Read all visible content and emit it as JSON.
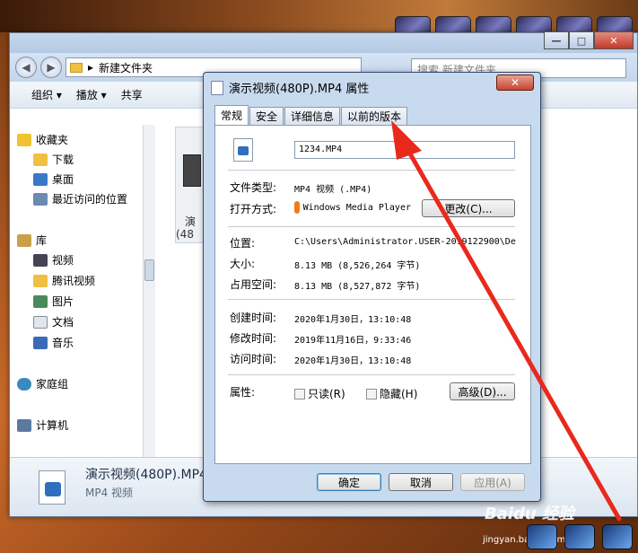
{
  "explorer": {
    "breadcrumb": "新建文件夹",
    "search_placeholder": "搜索 新建文件夹",
    "toolbar": {
      "organize": "组织 ▾",
      "play": "播放 ▾",
      "share": "共享"
    },
    "sidebar": {
      "favorites": "收藏夹",
      "downloads": "下载",
      "desktop": "桌面",
      "recent": "最近访问的位置",
      "libraries": "库",
      "videos": "视频",
      "tencent_video": "腾讯视频",
      "pictures": "图片",
      "documents": "文档",
      "music": "音乐",
      "homegroup": "家庭组",
      "computer": "计算机"
    },
    "file_thumb_label_1": "演",
    "file_thumb_label_2": "(48",
    "details": {
      "name": "演示视频(480P).MP4",
      "type": "MP4 视频"
    }
  },
  "dialog": {
    "title": "演示视频(480P).MP4 属性",
    "close_label": "✕",
    "tabs": [
      "常规",
      "安全",
      "详细信息",
      "以前的版本"
    ],
    "file_name": "1234.MP4",
    "labels": {
      "file_type": "文件类型:",
      "open_with": "打开方式:",
      "location": "位置:",
      "size": "大小:",
      "size_on_disk": "占用空间:",
      "created": "创建时间:",
      "modified": "修改时间:",
      "accessed": "访问时间:",
      "attributes": "属性:"
    },
    "values": {
      "file_type": "MP4 视频 (.MP4)",
      "open_with": "Windows Media Player",
      "location": "C:\\Users\\Administrator.USER-2019122900\\De",
      "size": "8.13 MB (8,526,264 字节)",
      "size_on_disk": "8.13 MB (8,527,872 字节)",
      "created": "2020年1月30日，13:10:48",
      "modified": "2019年11月16日，9:33:46",
      "accessed": "2020年1月30日，13:10:48"
    },
    "change_button": "更改(C)...",
    "readonly": "只读(R)",
    "hidden": "隐藏(H)",
    "advanced_button": "高级(D)...",
    "ok": "确定",
    "cancel": "取消",
    "apply": "应用(A)"
  },
  "watermark": {
    "main": "Baidu 经验",
    "sub": "jingyan.baidu.com"
  },
  "colors": {
    "arrow": "#e8291c",
    "dialog_frame": "#c8daee",
    "accent": "#3c7fb1"
  }
}
